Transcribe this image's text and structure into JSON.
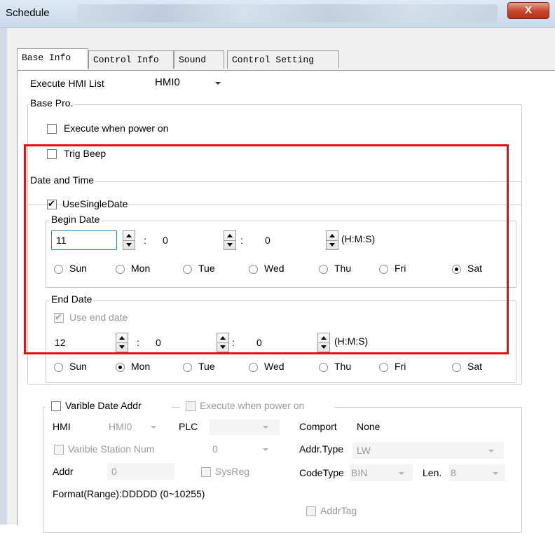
{
  "window": {
    "title": "Schedule",
    "close_glyph": "X"
  },
  "tabs": [
    "Base Info",
    "Control Info",
    "Sound",
    "Control Setting"
  ],
  "execute_hmi": {
    "label": "Execute HMI List",
    "value": "HMI0"
  },
  "base_pro": {
    "title": "Base Pro.",
    "execute_power_on": "Execute when power on",
    "trig_beep": "Trig Beep"
  },
  "date_time": {
    "title": "Date and Time",
    "use_single_date": "UseSingleDate",
    "begin": {
      "title": "Begin Date",
      "h": "11",
      "m": "0",
      "s": "0",
      "unit": "(H:M:S)",
      "selected_day": "Sat"
    },
    "end": {
      "title": "End Date",
      "use_end_date": "Use end date",
      "h": "12",
      "m": "0",
      "s": "0",
      "unit": "(H:M:S)",
      "selected_day": "Mon"
    },
    "colon": ":",
    "days": [
      "Sun",
      "Mon",
      "Tue",
      "Wed",
      "Thu",
      "Fri",
      "Sat"
    ]
  },
  "varible": {
    "varible_date_addr": "Varible Date Addr",
    "execute_power_on": "Execute when power on",
    "hmi_label": "HMI",
    "hmi_value": "HMI0",
    "plc_label": "PLC",
    "plc_value": "",
    "comport_label": "Comport",
    "comport_value": "None",
    "station_label": "Varible Station Num",
    "station_value": "0",
    "addr_type_label": "Addr.Type",
    "addr_type_value": "LW",
    "addr_label": "Addr",
    "addr_value": "0",
    "sysreg_label": "SysReg",
    "code_type_label": "CodeType",
    "code_type_value": "BIN",
    "len_label": "Len.",
    "len_value": "8",
    "format": "Format(Range):DDDDD (0~10255)",
    "addrtag": "AddrTag"
  },
  "colors": {
    "highlight": "#e01010",
    "close": "#c7452c"
  }
}
